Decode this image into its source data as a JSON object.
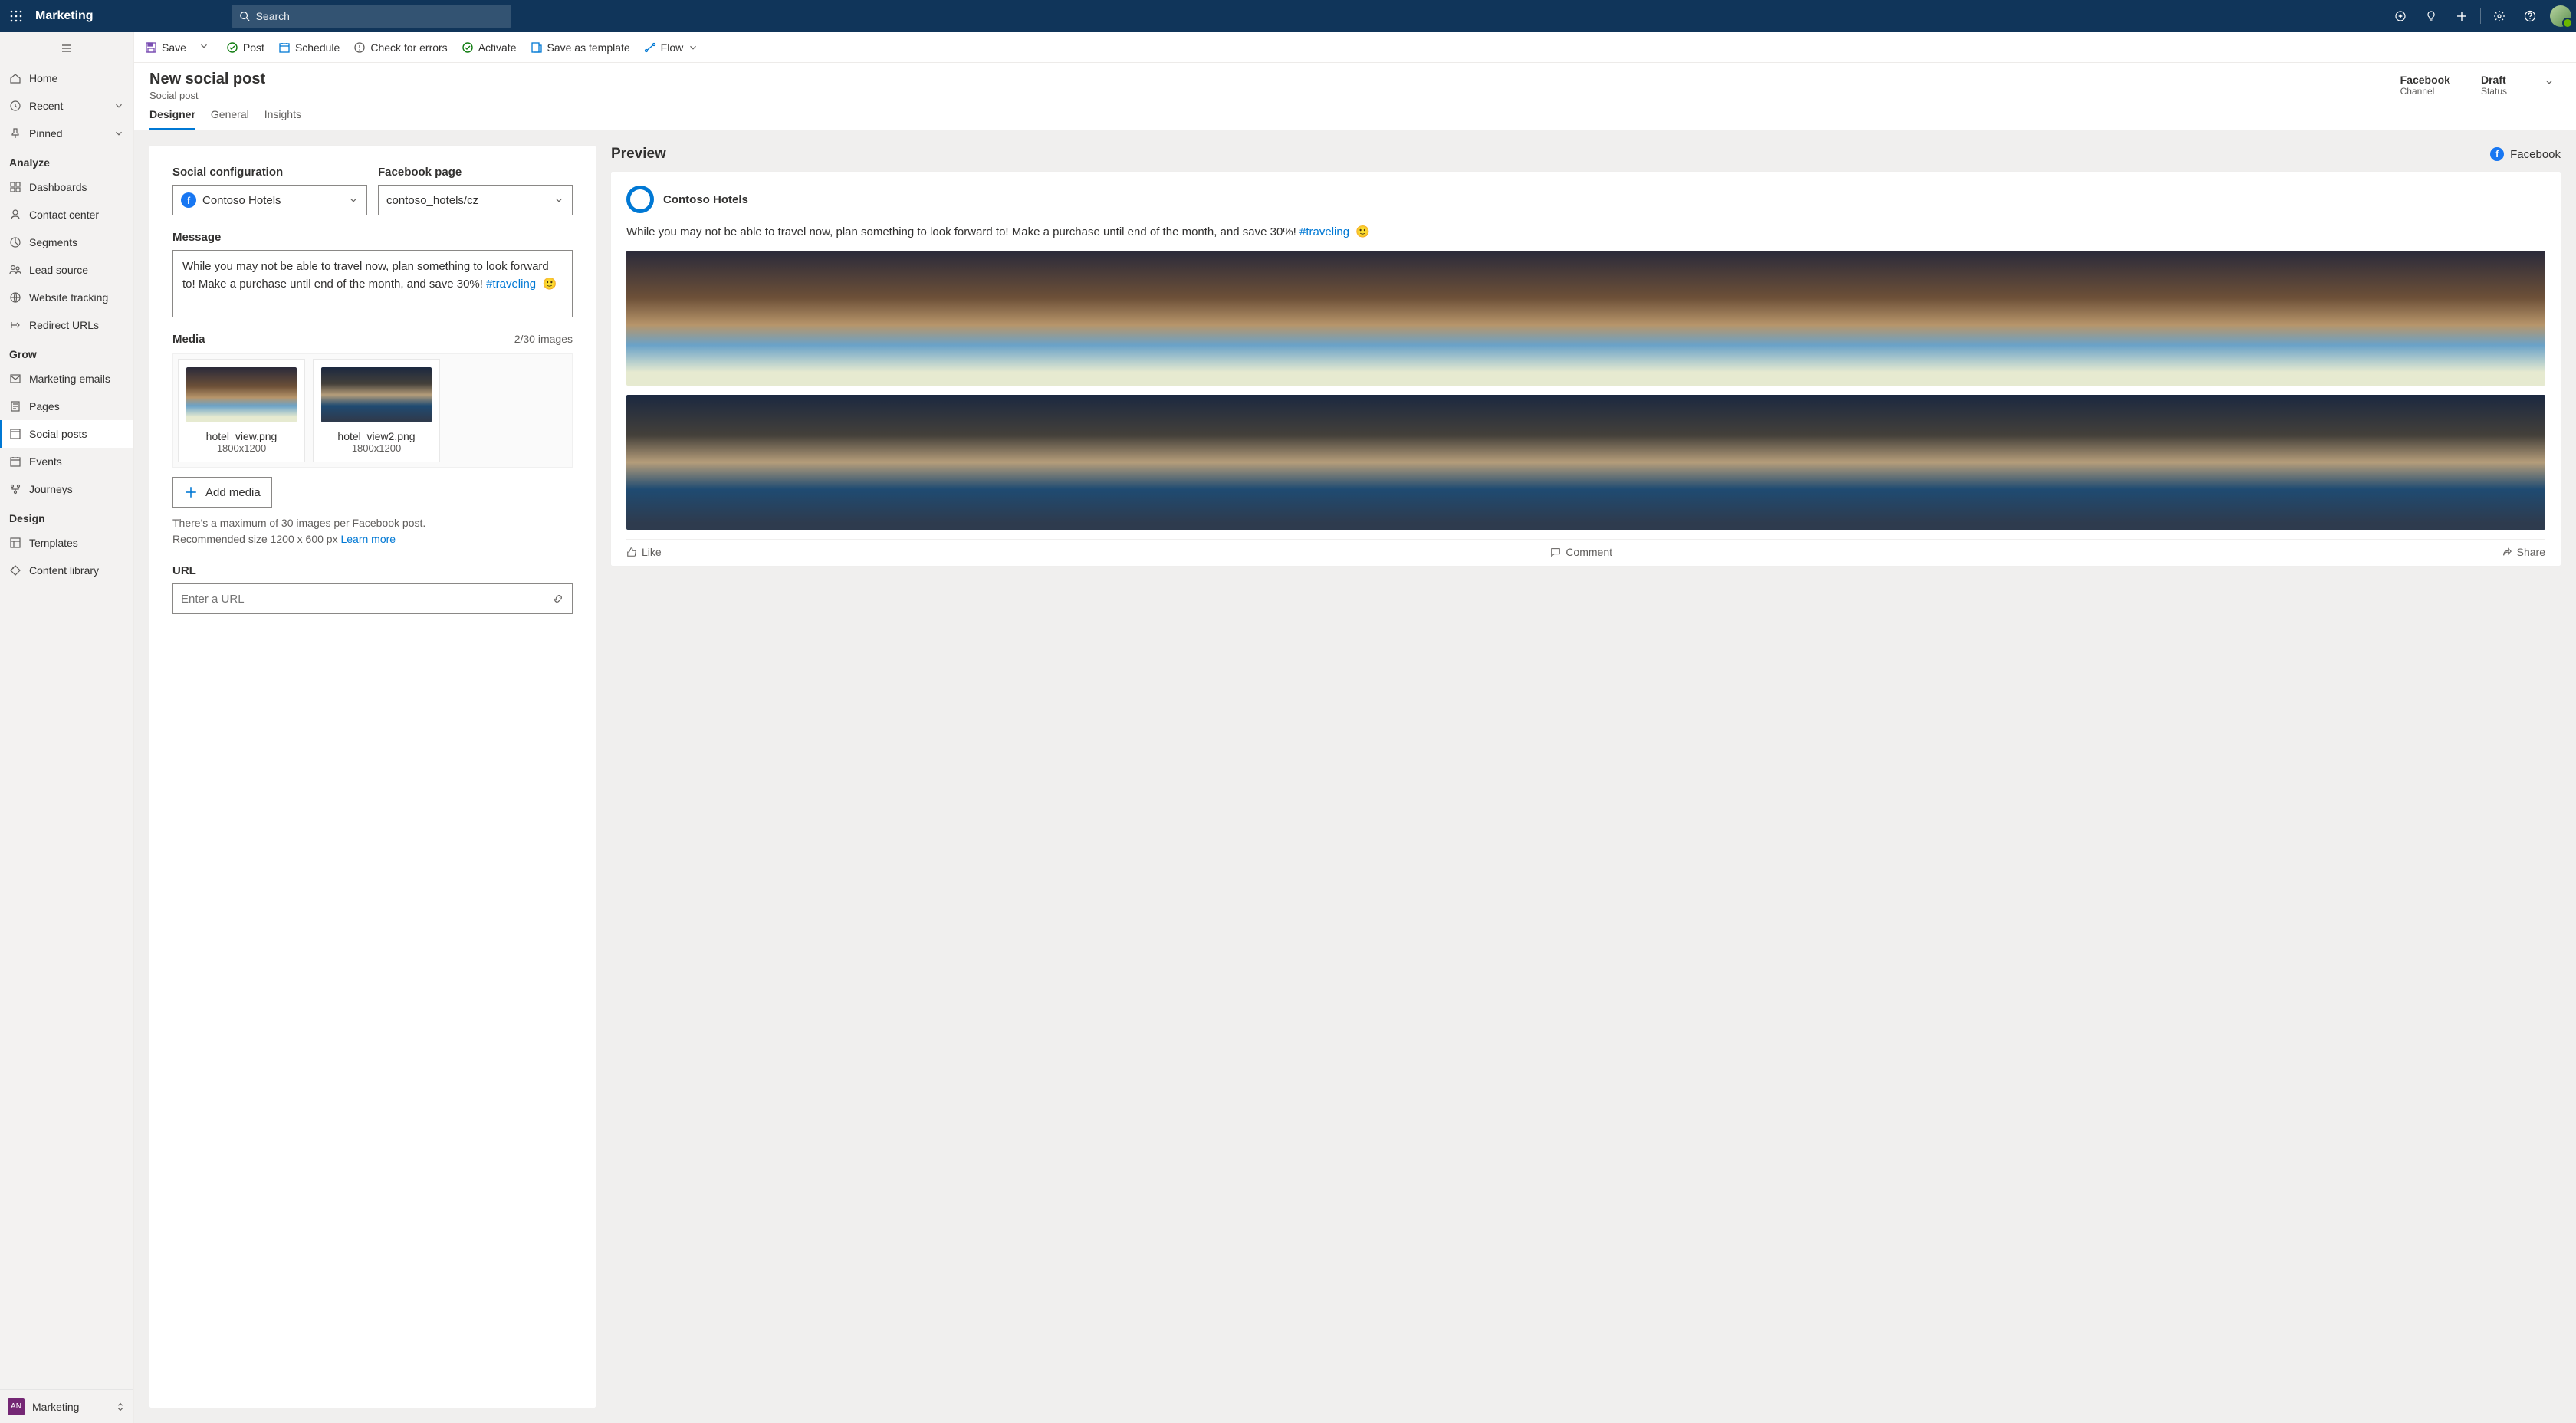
{
  "topbar": {
    "app_name": "Marketing",
    "search_placeholder": "Search"
  },
  "leftnav": {
    "top": [
      {
        "label": "Home",
        "icon": "home"
      },
      {
        "label": "Recent",
        "icon": "clock",
        "chevron": true
      },
      {
        "label": "Pinned",
        "icon": "pin",
        "chevron": true
      }
    ],
    "sections": [
      {
        "label": "Analyze",
        "items": [
          {
            "label": "Dashboards",
            "icon": "dashboard"
          },
          {
            "label": "Contact center",
            "icon": "person"
          },
          {
            "label": "Segments",
            "icon": "segments"
          },
          {
            "label": "Lead source",
            "icon": "people"
          },
          {
            "label": "Website tracking",
            "icon": "globe"
          },
          {
            "label": "Redirect URLs",
            "icon": "redirect"
          }
        ]
      },
      {
        "label": "Grow",
        "items": [
          {
            "label": "Marketing emails",
            "icon": "mail"
          },
          {
            "label": "Pages",
            "icon": "page"
          },
          {
            "label": "Social posts",
            "icon": "social",
            "selected": true
          },
          {
            "label": "Events",
            "icon": "calendar"
          },
          {
            "label": "Journeys",
            "icon": "journey"
          }
        ]
      },
      {
        "label": "Design",
        "items": [
          {
            "label": "Templates",
            "icon": "template"
          },
          {
            "label": "Content library",
            "icon": "tag"
          }
        ]
      }
    ],
    "app_switcher": {
      "badge": "AN",
      "label": "Marketing"
    }
  },
  "cmdbar": {
    "save": "Save",
    "post": "Post",
    "schedule": "Schedule",
    "check": "Check for errors",
    "activate": "Activate",
    "save_template": "Save as template",
    "flow": "Flow"
  },
  "header": {
    "title": "New social post",
    "subtitle": "Social post",
    "meta": [
      {
        "value": "Facebook",
        "label": "Channel"
      },
      {
        "value": "Draft",
        "label": "Status"
      }
    ]
  },
  "tabs": [
    "Designer",
    "General",
    "Insights"
  ],
  "form": {
    "social_config_label": "Social configuration",
    "social_config_value": "Contoso Hotels",
    "page_label": "Facebook page",
    "page_value": "contoso_hotels/cz",
    "message_label": "Message",
    "message_text": "While you may not be able to travel now, plan something to look forward to! Make a purchase until end of the month, and save 30%!",
    "message_hashtag": "#traveling",
    "message_emoji": "🙂",
    "media_label": "Media",
    "media_count": "2/30 images",
    "media_items": [
      {
        "filename": "hotel_view.png",
        "dims": "1800x1200"
      },
      {
        "filename": "hotel_view2.png",
        "dims": "1800x1200"
      }
    ],
    "add_media": "Add media",
    "helper_line1": "There's a maximum of 30 images per Facebook post.",
    "helper_line2": "Recommended size 1200 x 600 px",
    "learn_more": "Learn more",
    "url_label": "URL",
    "url_placeholder": "Enter a URL"
  },
  "preview": {
    "title": "Preview",
    "channel": "Facebook",
    "account": "Contoso Hotels",
    "text": "While you may not be able to travel now, plan something to look forward to! Make a purchase until end of the month, and save 30%!",
    "hashtag": "#traveling",
    "emoji": "🙂",
    "actions": {
      "like": "Like",
      "comment": "Comment",
      "share": "Share"
    }
  }
}
